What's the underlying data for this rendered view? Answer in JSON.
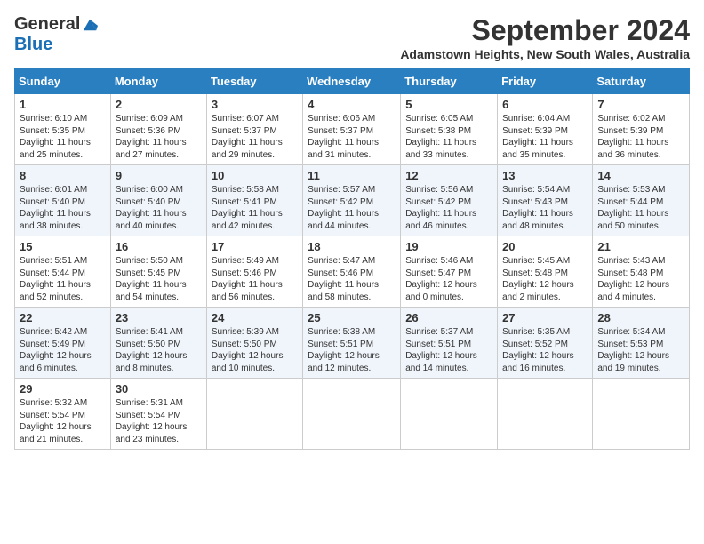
{
  "header": {
    "logo_general": "General",
    "logo_blue": "Blue",
    "month_title": "September 2024",
    "location": "Adamstown Heights, New South Wales, Australia"
  },
  "weekdays": [
    "Sunday",
    "Monday",
    "Tuesday",
    "Wednesday",
    "Thursday",
    "Friday",
    "Saturday"
  ],
  "weeks": [
    [
      {
        "day": "1",
        "sunrise": "6:10 AM",
        "sunset": "5:35 PM",
        "daylight": "11 hours and 25 minutes."
      },
      {
        "day": "2",
        "sunrise": "6:09 AM",
        "sunset": "5:36 PM",
        "daylight": "11 hours and 27 minutes."
      },
      {
        "day": "3",
        "sunrise": "6:07 AM",
        "sunset": "5:37 PM",
        "daylight": "11 hours and 29 minutes."
      },
      {
        "day": "4",
        "sunrise": "6:06 AM",
        "sunset": "5:37 PM",
        "daylight": "11 hours and 31 minutes."
      },
      {
        "day": "5",
        "sunrise": "6:05 AM",
        "sunset": "5:38 PM",
        "daylight": "11 hours and 33 minutes."
      },
      {
        "day": "6",
        "sunrise": "6:04 AM",
        "sunset": "5:39 PM",
        "daylight": "11 hours and 35 minutes."
      },
      {
        "day": "7",
        "sunrise": "6:02 AM",
        "sunset": "5:39 PM",
        "daylight": "11 hours and 36 minutes."
      }
    ],
    [
      {
        "day": "8",
        "sunrise": "6:01 AM",
        "sunset": "5:40 PM",
        "daylight": "11 hours and 38 minutes."
      },
      {
        "day": "9",
        "sunrise": "6:00 AM",
        "sunset": "5:40 PM",
        "daylight": "11 hours and 40 minutes."
      },
      {
        "day": "10",
        "sunrise": "5:58 AM",
        "sunset": "5:41 PM",
        "daylight": "11 hours and 42 minutes."
      },
      {
        "day": "11",
        "sunrise": "5:57 AM",
        "sunset": "5:42 PM",
        "daylight": "11 hours and 44 minutes."
      },
      {
        "day": "12",
        "sunrise": "5:56 AM",
        "sunset": "5:42 PM",
        "daylight": "11 hours and 46 minutes."
      },
      {
        "day": "13",
        "sunrise": "5:54 AM",
        "sunset": "5:43 PM",
        "daylight": "11 hours and 48 minutes."
      },
      {
        "day": "14",
        "sunrise": "5:53 AM",
        "sunset": "5:44 PM",
        "daylight": "11 hours and 50 minutes."
      }
    ],
    [
      {
        "day": "15",
        "sunrise": "5:51 AM",
        "sunset": "5:44 PM",
        "daylight": "11 hours and 52 minutes."
      },
      {
        "day": "16",
        "sunrise": "5:50 AM",
        "sunset": "5:45 PM",
        "daylight": "11 hours and 54 minutes."
      },
      {
        "day": "17",
        "sunrise": "5:49 AM",
        "sunset": "5:46 PM",
        "daylight": "11 hours and 56 minutes."
      },
      {
        "day": "18",
        "sunrise": "5:47 AM",
        "sunset": "5:46 PM",
        "daylight": "11 hours and 58 minutes."
      },
      {
        "day": "19",
        "sunrise": "5:46 AM",
        "sunset": "5:47 PM",
        "daylight": "12 hours and 0 minutes."
      },
      {
        "day": "20",
        "sunrise": "5:45 AM",
        "sunset": "5:48 PM",
        "daylight": "12 hours and 2 minutes."
      },
      {
        "day": "21",
        "sunrise": "5:43 AM",
        "sunset": "5:48 PM",
        "daylight": "12 hours and 4 minutes."
      }
    ],
    [
      {
        "day": "22",
        "sunrise": "5:42 AM",
        "sunset": "5:49 PM",
        "daylight": "12 hours and 6 minutes."
      },
      {
        "day": "23",
        "sunrise": "5:41 AM",
        "sunset": "5:50 PM",
        "daylight": "12 hours and 8 minutes."
      },
      {
        "day": "24",
        "sunrise": "5:39 AM",
        "sunset": "5:50 PM",
        "daylight": "12 hours and 10 minutes."
      },
      {
        "day": "25",
        "sunrise": "5:38 AM",
        "sunset": "5:51 PM",
        "daylight": "12 hours and 12 minutes."
      },
      {
        "day": "26",
        "sunrise": "5:37 AM",
        "sunset": "5:51 PM",
        "daylight": "12 hours and 14 minutes."
      },
      {
        "day": "27",
        "sunrise": "5:35 AM",
        "sunset": "5:52 PM",
        "daylight": "12 hours and 16 minutes."
      },
      {
        "day": "28",
        "sunrise": "5:34 AM",
        "sunset": "5:53 PM",
        "daylight": "12 hours and 19 minutes."
      }
    ],
    [
      {
        "day": "29",
        "sunrise": "5:32 AM",
        "sunset": "5:54 PM",
        "daylight": "12 hours and 21 minutes."
      },
      {
        "day": "30",
        "sunrise": "5:31 AM",
        "sunset": "5:54 PM",
        "daylight": "12 hours and 23 minutes."
      },
      null,
      null,
      null,
      null,
      null
    ]
  ],
  "labels": {
    "sunrise": "Sunrise:",
    "sunset": "Sunset:",
    "daylight": "Daylight:"
  }
}
